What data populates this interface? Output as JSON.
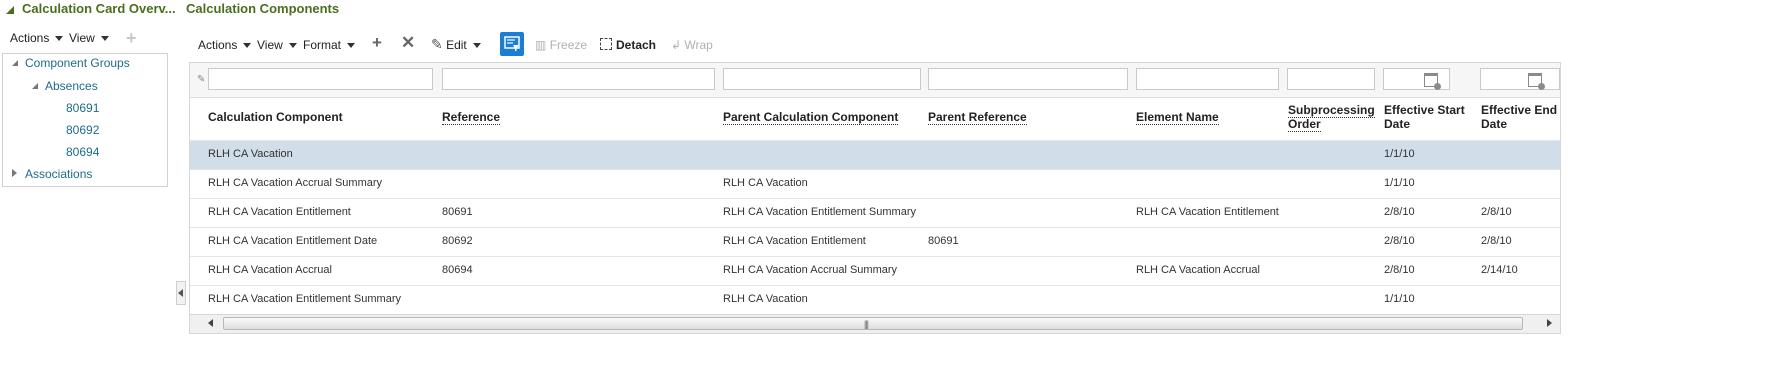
{
  "page": {
    "left_title": "Calculation Card Overv...",
    "right_title": "Calculation Components"
  },
  "left_toolbar": {
    "actions": "Actions",
    "view": "View"
  },
  "tree": {
    "component_groups": "Component Groups",
    "absences": "Absences",
    "items": [
      "80691",
      "80692",
      "80694"
    ],
    "associations": "Associations"
  },
  "toolbar": {
    "actions": "Actions",
    "view": "View",
    "format": "Format",
    "edit": "Edit",
    "freeze": "Freeze",
    "detach": "Detach",
    "wrap": "Wrap"
  },
  "table": {
    "headers": {
      "calc_component": "Calculation Component",
      "reference": "Reference",
      "parent_calc": "Parent Calculation Component",
      "parent_ref": "Parent Reference",
      "element_name": "Element Name",
      "subprocessing_1": "Subprocessing",
      "subprocessing_2": "Order",
      "eff_start_1": "Effective Start",
      "eff_start_2": "Date",
      "eff_end_1": "Effective End",
      "eff_end_2": "Date"
    },
    "rows": [
      {
        "component": "RLH CA Vacation",
        "reference": "",
        "parent": "",
        "parent_ref": "",
        "element": "",
        "order": "",
        "start": "1/1/10",
        "end": ""
      },
      {
        "component": "RLH CA Vacation Accrual Summary",
        "reference": "",
        "parent": "RLH CA Vacation",
        "parent_ref": "",
        "element": "",
        "order": "",
        "start": "1/1/10",
        "end": ""
      },
      {
        "component": "RLH CA Vacation Entitlement",
        "reference": "80691",
        "parent": "RLH CA Vacation Entitlement Summary",
        "parent_ref": "",
        "element": "RLH CA Vacation Entitlement",
        "order": "",
        "start": "2/8/10",
        "end": "2/8/10"
      },
      {
        "component": "RLH CA Vacation Entitlement Date",
        "reference": "80692",
        "parent": "RLH CA Vacation Entitlement",
        "parent_ref": "80691",
        "element": "",
        "order": "",
        "start": "2/8/10",
        "end": "2/8/10"
      },
      {
        "component": "RLH CA Vacation Accrual",
        "reference": "80694",
        "parent": "RLH CA Vacation Accrual Summary",
        "parent_ref": "",
        "element": "RLH CA Vacation Accrual",
        "order": "",
        "start": "2/8/10",
        "end": "2/14/10"
      },
      {
        "component": "RLH CA Vacation Entitlement Summary",
        "reference": "",
        "parent": "RLH CA Vacation",
        "parent_ref": "",
        "element": "",
        "order": "",
        "start": "1/1/10",
        "end": ""
      }
    ]
  }
}
